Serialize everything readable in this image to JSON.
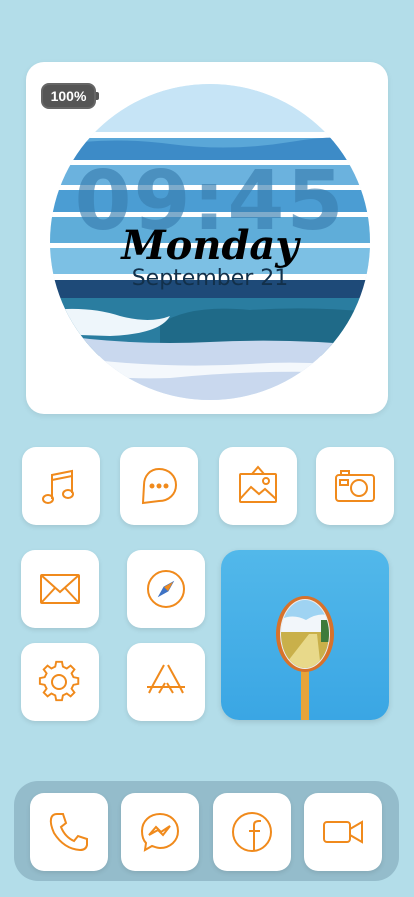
{
  "widget": {
    "battery": "100%",
    "time": "09:45",
    "day": "Monday",
    "date": "September 21"
  },
  "apps": {
    "row1": [
      {
        "name": "music",
        "icon": "music-note-icon"
      },
      {
        "name": "messages",
        "icon": "chat-bubble-icon"
      },
      {
        "name": "photos",
        "icon": "picture-frame-icon"
      },
      {
        "name": "camera",
        "icon": "camera-icon"
      }
    ],
    "row2": [
      {
        "name": "mail",
        "icon": "envelope-icon"
      },
      {
        "name": "safari",
        "icon": "compass-icon"
      }
    ],
    "row3": [
      {
        "name": "settings",
        "icon": "gear-icon"
      },
      {
        "name": "app-store",
        "icon": "app-store-icon"
      }
    ]
  },
  "dock": [
    {
      "name": "phone",
      "icon": "phone-icon"
    },
    {
      "name": "messenger",
      "icon": "messenger-icon"
    },
    {
      "name": "facebook",
      "icon": "facebook-icon"
    },
    {
      "name": "facetime",
      "icon": "video-camera-icon"
    }
  ],
  "colors": {
    "background": "#b3dde9",
    "icon_stroke": "#f08a1c",
    "dock": "#94bccb"
  }
}
